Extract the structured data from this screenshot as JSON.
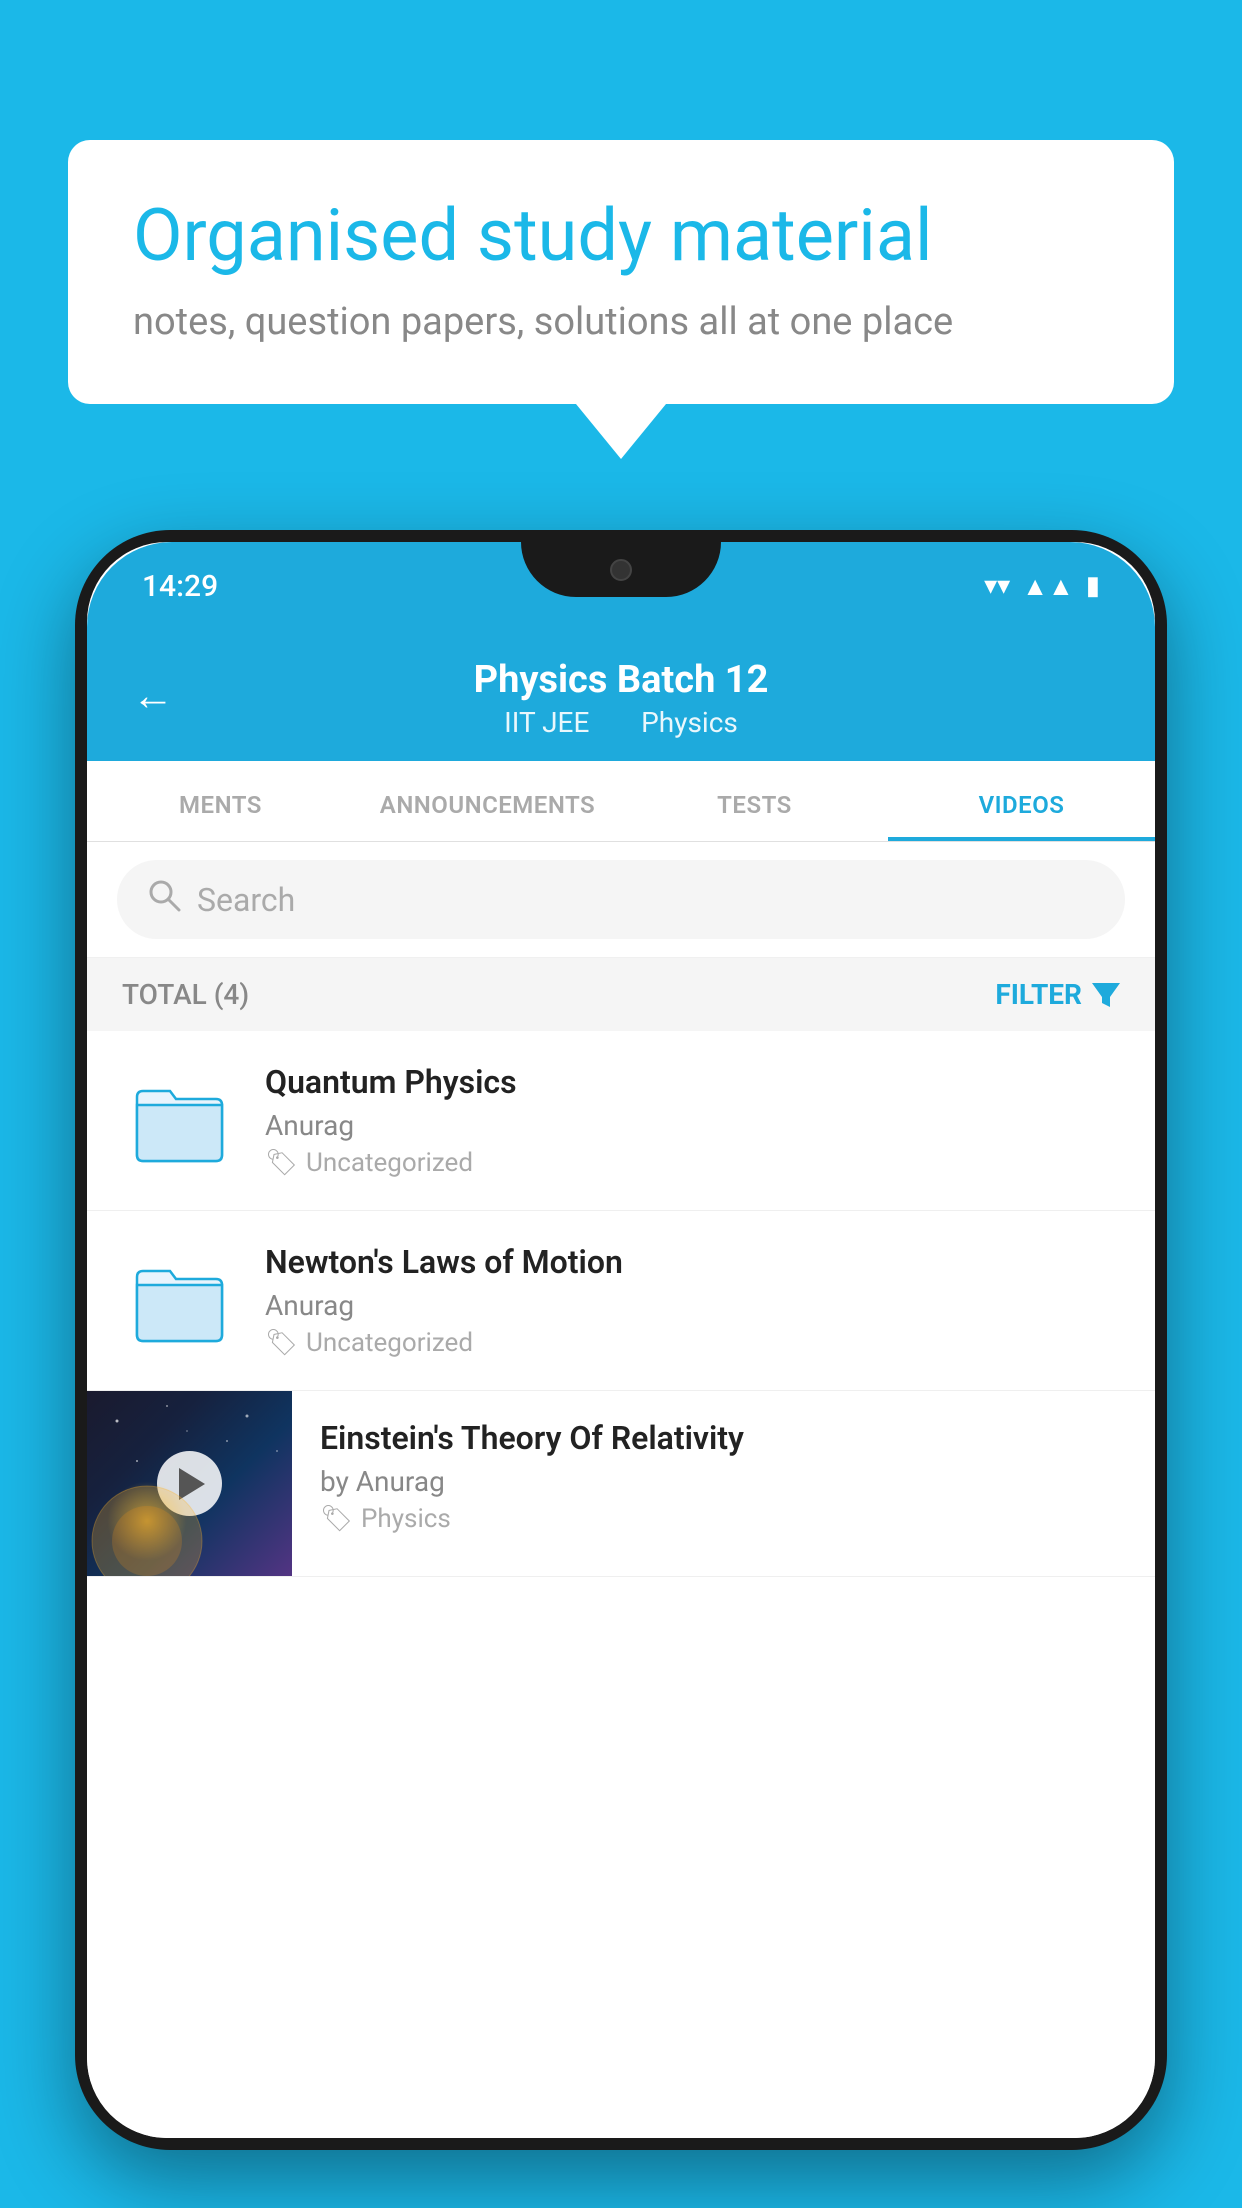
{
  "background_color": "#1bb8e8",
  "speech_bubble": {
    "title": "Organised study material",
    "subtitle": "notes, question papers, solutions all at one place"
  },
  "phone": {
    "status_bar": {
      "time": "14:29"
    },
    "header": {
      "title": "Physics Batch 12",
      "subtitle_parts": [
        "IIT JEE",
        "Physics"
      ],
      "back_label": "←"
    },
    "tabs": [
      {
        "label": "MENTS",
        "active": false
      },
      {
        "label": "ANNOUNCEMENTS",
        "active": false
      },
      {
        "label": "TESTS",
        "active": false
      },
      {
        "label": "VIDEOS",
        "active": true
      }
    ],
    "search": {
      "placeholder": "Search"
    },
    "filter_bar": {
      "total_label": "TOTAL (4)",
      "filter_label": "FILTER"
    },
    "videos": [
      {
        "id": 1,
        "title": "Quantum Physics",
        "author": "Anurag",
        "tag": "Uncategorized",
        "type": "folder"
      },
      {
        "id": 2,
        "title": "Newton's Laws of Motion",
        "author": "Anurag",
        "tag": "Uncategorized",
        "type": "folder"
      },
      {
        "id": 3,
        "title": "Einstein's Theory Of Relativity",
        "author": "by Anurag",
        "tag": "Physics",
        "type": "video"
      }
    ]
  }
}
